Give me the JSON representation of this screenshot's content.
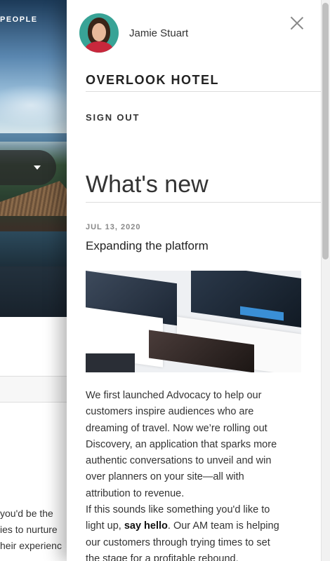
{
  "background": {
    "hero_label": "PEOPLE",
    "text_lines": [
      "you'd be the",
      "ies to nurture",
      "heir experienc"
    ]
  },
  "drawer": {
    "user_name": "Jamie Stuart",
    "hotel_name": "OVERLOOK HOTEL",
    "sign_out": "SIGN OUT",
    "heading": "What's new",
    "article": {
      "date": "JUL 13, 2020",
      "title": "Expanding the platform",
      "lines": [
        "We first launched Advocacy to help our",
        "customers inspire audiences who are",
        "dreaming of travel. Now we’re rolling out",
        "Discovery, an application that sparks more",
        "authentic conversations to unveil and win",
        "over planners on your site—all with",
        "attribution to revenue.",
        "If this sounds like something you'd like to"
      ],
      "line_before_link": "light up, ",
      "link_text": "say hello",
      "line_after_link": ". Our AM team is helping",
      "lines_after": [
        "our customers through trying times to set",
        "the stage for a profitable rebound."
      ]
    }
  },
  "icons": {
    "close": "close-icon",
    "dropdown": "chevron-down-icon",
    "avatar": "avatar"
  }
}
